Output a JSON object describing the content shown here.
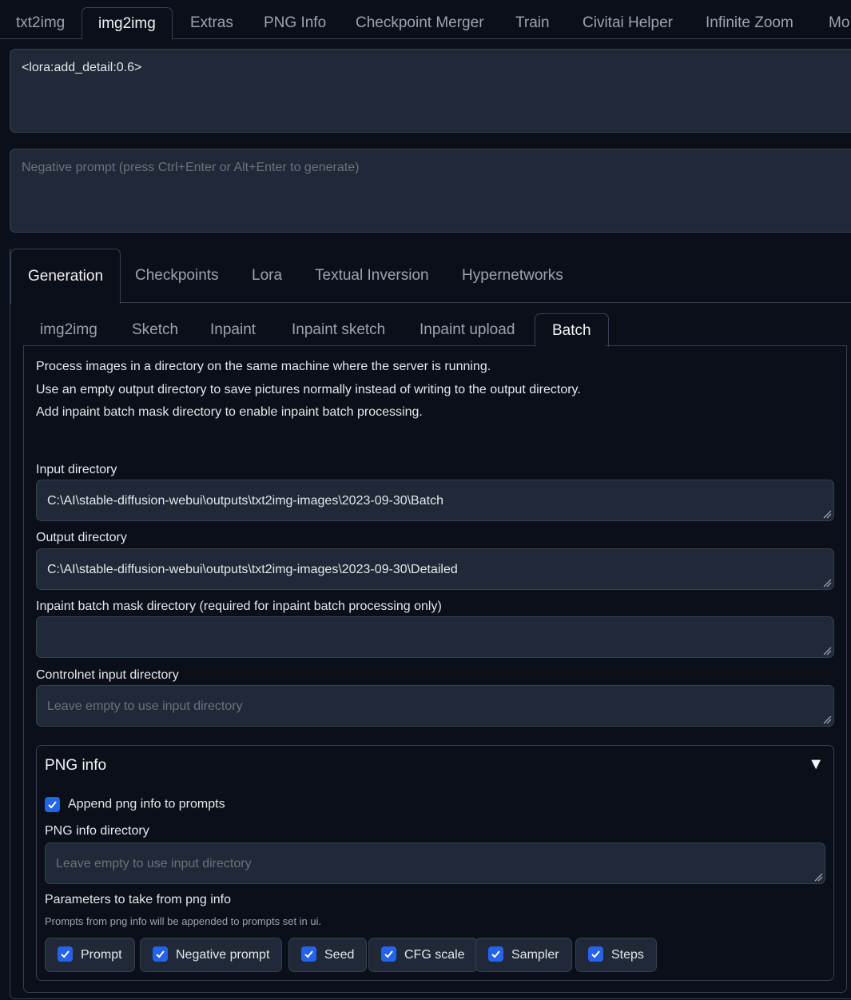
{
  "top_tabs": [
    {
      "label": "txt2img",
      "active": false
    },
    {
      "label": "img2img",
      "active": true
    },
    {
      "label": "Extras",
      "active": false
    },
    {
      "label": "PNG Info",
      "active": false
    },
    {
      "label": "Checkpoint Merger",
      "active": false
    },
    {
      "label": "Train",
      "active": false
    },
    {
      "label": "Civitai Helper",
      "active": false
    },
    {
      "label": "Infinite Zoom",
      "active": false
    },
    {
      "label": "Mo",
      "active": false
    }
  ],
  "prompt": {
    "value": "<lora:add_detail:0.6>"
  },
  "negative_prompt": {
    "value": "",
    "placeholder": "Negative prompt (press Ctrl+Enter or Alt+Enter to generate)"
  },
  "network_tabs": [
    {
      "label": "Generation",
      "active": true
    },
    {
      "label": "Checkpoints",
      "active": false
    },
    {
      "label": "Lora",
      "active": false
    },
    {
      "label": "Textual Inversion",
      "active": false
    },
    {
      "label": "Hypernetworks",
      "active": false
    }
  ],
  "mode_tabs": [
    {
      "label": "img2img",
      "active": false
    },
    {
      "label": "Sketch",
      "active": false
    },
    {
      "label": "Inpaint",
      "active": false
    },
    {
      "label": "Inpaint sketch",
      "active": false
    },
    {
      "label": "Inpaint upload",
      "active": false
    },
    {
      "label": "Batch",
      "active": true
    }
  ],
  "batch": {
    "info": [
      "Process images in a directory on the same machine where the server is running.",
      "Use an empty output directory to save pictures normally instead of writing to the output directory.",
      "Add inpaint batch mask directory to enable inpaint batch processing."
    ],
    "input_dir": {
      "label": "Input directory",
      "value": "C:\\AI\\stable-diffusion-webui\\outputs\\txt2img-images\\2023-09-30\\Batch"
    },
    "output_dir": {
      "label": "Output directory",
      "value": "C:\\AI\\stable-diffusion-webui\\outputs\\txt2img-images\\2023-09-30\\Detailed"
    },
    "mask_dir": {
      "label": "Inpaint batch mask directory (required for inpaint batch processing only)",
      "value": ""
    },
    "controlnet_dir": {
      "label": "Controlnet input directory",
      "placeholder": "Leave empty to use input directory"
    }
  },
  "png_info": {
    "title": "PNG info",
    "toggle": "▼",
    "append_label": "Append png info to prompts",
    "append_checked": true,
    "dir_label": "PNG info directory",
    "dir_placeholder": "Leave empty to use input directory",
    "params_label": "Parameters to take from png info",
    "params_note": "Prompts from png info will be appended to prompts set in ui.",
    "params": [
      {
        "label": "Prompt",
        "checked": true
      },
      {
        "label": "Negative prompt",
        "checked": true
      },
      {
        "label": "Seed",
        "checked": true
      },
      {
        "label": "CFG scale",
        "checked": true
      },
      {
        "label": "Sampler",
        "checked": true
      },
      {
        "label": "Steps",
        "checked": true
      }
    ]
  },
  "colors": {
    "background": "#0b0f19",
    "panel": "#1f2937",
    "border": "#374151",
    "checkbox": "#2563eb"
  }
}
